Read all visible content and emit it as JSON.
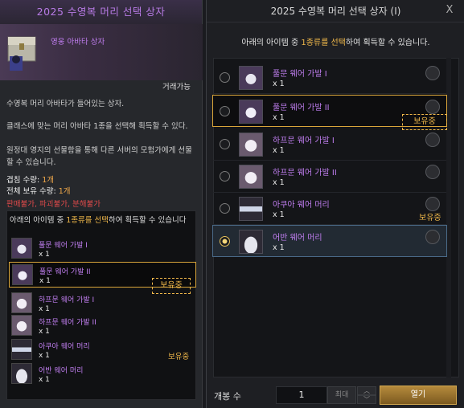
{
  "left": {
    "title": "2025 수영복 머리 선택 상자",
    "item_name": "영웅 아바타 상자",
    "trade": "거래가능",
    "desc1": "수영복 머리 아바타가 들어있는 상자.",
    "desc2": "클래스에 맞는 머리 아바타 1종을 선택해 획득할 수 있다.",
    "desc3": "원정대 영지의 선물함을 통해 다른 서버의 모험가에게 선물할 수 있습니다.",
    "stack_label": "겹침 수량: ",
    "stack_value": "1개",
    "total_label": "전체 보유 수량: ",
    "total_value": "1개",
    "warn_sell": "판매불가",
    "warn_destroy": "파괴불가",
    "warn_disassemble": "분해불가",
    "warn_sep": ", ",
    "select_head_pre": "아래의 아이템 중 ",
    "select_head_hl": "1종류를 선택",
    "select_head_post": "하여 획득할 수 있습니다",
    "items": [
      {
        "name": "풀문 웨어 가발 I",
        "qty": "x 1"
      },
      {
        "name": "풀문 웨어 가발 II",
        "qty": "x 1"
      },
      {
        "name": "하프문 웨어 가발 I",
        "qty": "x 1"
      },
      {
        "name": "하프문 웨어 가발 II",
        "qty": "x 1"
      },
      {
        "name": "아쿠아 웨어 머리",
        "qty": "x 1"
      },
      {
        "name": "어반 웨어 머리",
        "qty": "x 1"
      }
    ],
    "owned_label": "보유중",
    "owned_label_boxed": "보유중"
  },
  "right": {
    "title": "2025 수영복 머리 선택 상자 (I)",
    "close": "X",
    "head_pre": "아래의 아이템 중 ",
    "head_hl": "1종류를 선택",
    "head_post": "하여 획득할 수 있습니다.",
    "items": [
      {
        "name": "풀문 웨어 가발 I",
        "qty": "x 1"
      },
      {
        "name": "풀문 웨어 가발 II",
        "qty": "x 1"
      },
      {
        "name": "하프문 웨어 가발 I",
        "qty": "x 1"
      },
      {
        "name": "하프문 웨어 가발 II",
        "qty": "x 1"
      },
      {
        "name": "아쿠아 웨어 머리",
        "qty": "x 1"
      },
      {
        "name": "어반 웨어 머리",
        "qty": "x 1"
      }
    ],
    "owned_label": "보유중",
    "owned_label_boxed": "보유중",
    "open_count_label": "개봉 수",
    "qty_value": "1",
    "max_label": "최대",
    "step_up": "︿",
    "step_down": "﹀",
    "open_button": "열기"
  },
  "colors": {
    "item_purple": "#c07ef0",
    "accent_gold": "#f0b84a",
    "warn_red": "#e04a4a"
  }
}
